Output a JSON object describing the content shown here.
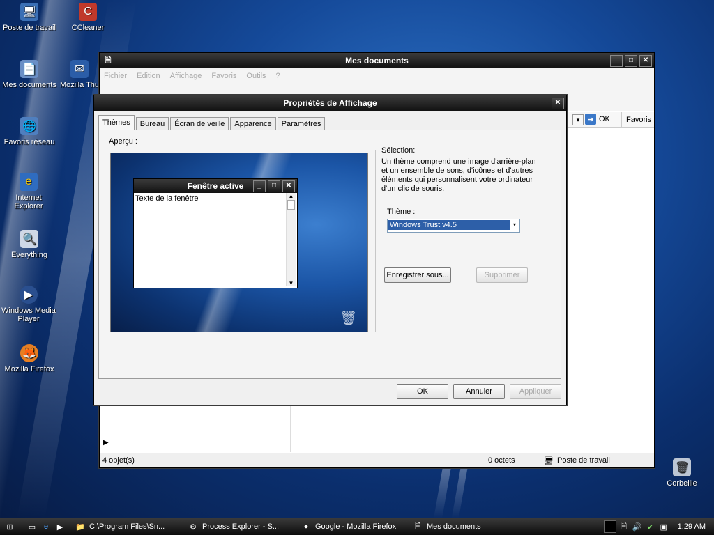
{
  "desktop": {
    "icons": [
      {
        "label": "Poste de travail",
        "icon": "computer-icon"
      },
      {
        "label": "CCleaner",
        "icon": "ccleaner-icon"
      },
      {
        "label": "Mes documents",
        "icon": "documents-icon"
      },
      {
        "label": "Mozilla Thunderb",
        "icon": "thunderbird-icon"
      },
      {
        "label": "Favoris réseau",
        "icon": "network-icon"
      },
      {
        "label": "Internet Explorer",
        "icon": "ie-icon"
      },
      {
        "label": "Everything",
        "icon": "everything-icon"
      },
      {
        "label": "Windows Media Player",
        "icon": "media-player-icon"
      },
      {
        "label": "Mozilla Firefox",
        "icon": "firefox-icon"
      },
      {
        "label": "Corbeille",
        "icon": "recycle-bin-icon"
      }
    ]
  },
  "explorer": {
    "title": "Mes documents",
    "menu": [
      "Fichier",
      "Edition",
      "Affichage",
      "Favoris",
      "Outils",
      "?"
    ],
    "go_label": "OK",
    "favorites_label": "Favoris",
    "status": {
      "objects": "4 objet(s)",
      "size": "0 octets",
      "location": "Poste de travail"
    }
  },
  "dialog": {
    "title": "Propriétés de Affichage",
    "tabs": [
      "Thèmes",
      "Bureau",
      "Écran de veille",
      "Apparence",
      "Paramètres"
    ],
    "preview_label": "Aperçu :",
    "mini_window": {
      "title": "Fenêtre active",
      "text": "Texte de la fenêtre"
    },
    "selection_label": "Sélection:",
    "description": "Un thème comprend une image d'arrière-plan et un ensemble de sons, d'icônes et d'autres éléments qui personnalisent votre ordinateur d'un clic de souris.",
    "theme_label": "Thème :",
    "theme_value": "Windows Trust v4.5",
    "save_as": "Enregistrer sous...",
    "delete": "Supprimer",
    "ok": "OK",
    "cancel": "Annuler",
    "apply": "Appliquer"
  },
  "taskbar": {
    "tasks": [
      {
        "label": "C:\\Program Files\\Sn...",
        "icon": "folder-icon"
      },
      {
        "label": "Process Explorer - S...",
        "icon": "process-explorer-icon"
      },
      {
        "label": "Google - Mozilla Firefox",
        "icon": "firefox-icon"
      },
      {
        "label": "Mes documents",
        "icon": "documents-icon"
      }
    ],
    "clock": "1:29 AM"
  }
}
